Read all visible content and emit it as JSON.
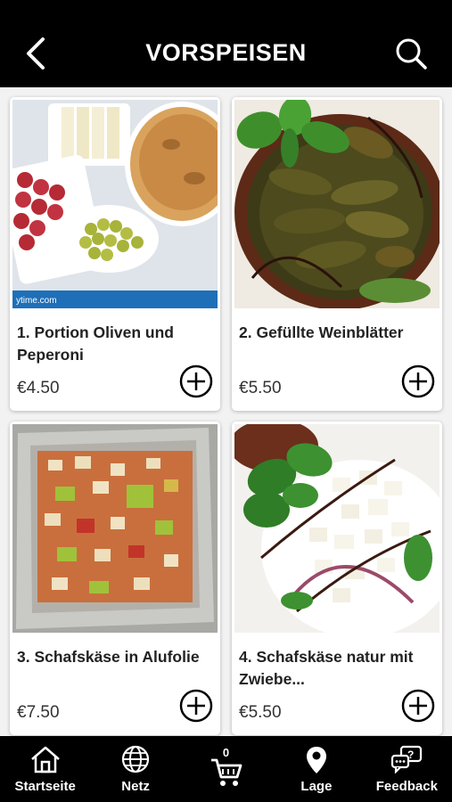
{
  "header": {
    "title": "VORSPEISEN",
    "back_icon": "chevron-left-icon",
    "search_icon": "search-icon"
  },
  "products": [
    {
      "name": "1. Portion Oliven und Peperoni",
      "price": "€4.50",
      "image_caption": "ytime.com"
    },
    {
      "name": "2. Gefüllte Weinblätter",
      "price": "€5.50"
    },
    {
      "name": "3. Schafskäse in Alufolie",
      "price": "€7.50"
    },
    {
      "name": "4. Schafskäse natur mit Zwiebe...",
      "price": "€5.50"
    }
  ],
  "nav": {
    "home": "Startseite",
    "net": "Netz",
    "cart_count": "0",
    "location": "Lage",
    "feedback": "Feedback"
  },
  "colors": {
    "bar": "#000000",
    "background": "#f2f2f2",
    "card": "#ffffff"
  }
}
